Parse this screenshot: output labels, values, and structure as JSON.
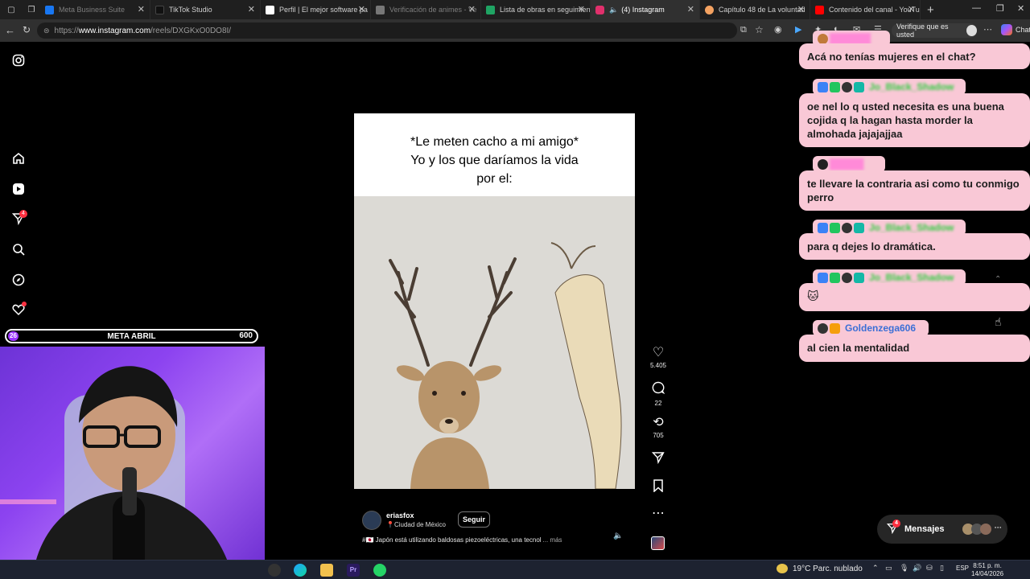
{
  "tabs": [
    {
      "title": "Meta Business Suite",
      "color": "#1877f2",
      "dim": true
    },
    {
      "title": "TikTok Studio",
      "color": "#111111",
      "dim": false
    },
    {
      "title": "Perfil | El mejor software pa",
      "color": "#ffffff",
      "dim": false
    },
    {
      "title": "Verificación de animes - Ve",
      "color": "#777777",
      "dim": true
    },
    {
      "title": "Lista de obras en seguimien",
      "color": "#1fa463",
      "dim": false
    },
    {
      "title": "(4) Instagram",
      "color": "#e1306c",
      "dim": false,
      "active": true
    },
    {
      "title": "Capítulo 48 de La voluntad",
      "color": "#f4a261",
      "dim": false
    },
    {
      "title": "Contenido del canal - YouTu",
      "color": "#ff0000",
      "dim": false
    }
  ],
  "address": {
    "scheme": "https://",
    "host": "www.instagram.com",
    "path": "/reels/DXGKxO0DO8I/"
  },
  "toolbar": {
    "verify_label": "Verifique que es usted",
    "chat_label": "Chat"
  },
  "sidebar": {
    "notifications_badge": "4"
  },
  "reel": {
    "caption_line1": "*Le meten cacho a mi amigo*",
    "caption_line2": "Yo y los que daríamos la vida",
    "caption_line3": "por el:",
    "author": "eriasfox",
    "location": "Ciudad de México",
    "follow_label": "Seguir",
    "description": "#🇯🇵 Japón está utilizando baldosas piezoeléctricas, una tecnol",
    "more_label": "... más"
  },
  "actions": {
    "likes": "5.405",
    "comments": "22",
    "reposts": "705"
  },
  "chat": [
    {
      "user": "",
      "text": "Acá no tenías mujeres en el chat?"
    },
    {
      "user": "Jo_Black_Shadow",
      "text": "oe nel lo q usted necesita es una buena cojida q la hagan hasta morder la almohada jajajajjaa"
    },
    {
      "user": "",
      "text": "te llevare la contraria asi como tu conmigo perro"
    },
    {
      "user": "Jo_Black_Shadow",
      "text": "para q dejes lo dramática."
    },
    {
      "user": "Jo_Black_Shadow",
      "text": ""
    },
    {
      "user": "Goldenzega606",
      "text": "al cien la mentalidad"
    }
  ],
  "meta_overlay": {
    "label": "META ABRIL",
    "current": "26",
    "goal": "600"
  },
  "messages": {
    "label": "Mensajes",
    "badge": "4"
  },
  "taskbar": {
    "weather_temp": "19°C",
    "weather_text": "Parc. nublado",
    "lang": "ESP",
    "time": "8:51 p. m.",
    "date": "14/04/2026"
  },
  "colors": {
    "chat_bubble": "#f9c8d6",
    "accent_purple": "#9b35ff",
    "name_green": "#2ecc40",
    "name_blue": "#3b6fd6"
  }
}
